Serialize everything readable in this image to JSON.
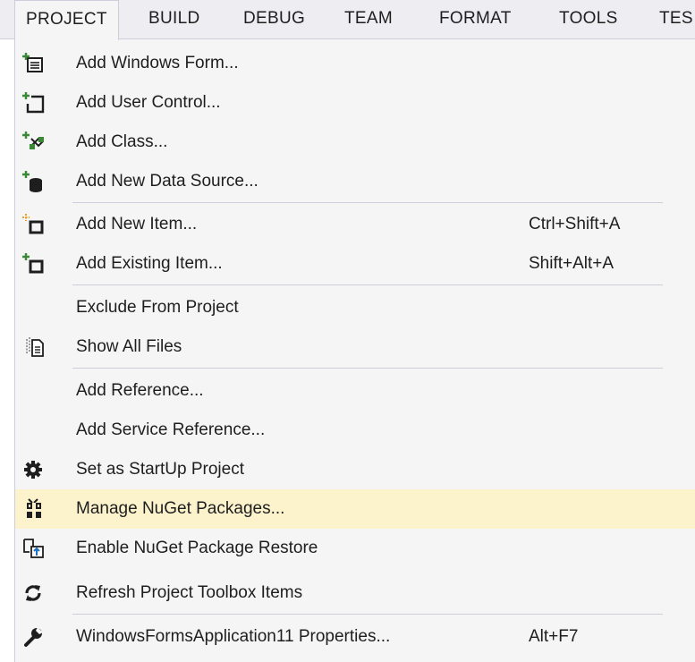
{
  "menubar": {
    "items": [
      {
        "label": "PROJECT",
        "active": true
      },
      {
        "label": "BUILD"
      },
      {
        "label": "DEBUG"
      },
      {
        "label": "TEAM"
      },
      {
        "label": "FORMAT"
      },
      {
        "label": "TOOLS"
      },
      {
        "label": "TES"
      }
    ]
  },
  "menu": {
    "highlight_color": "#fcf3cd",
    "items": [
      {
        "label": "Add Windows Form...",
        "icon": "add-windows-form-icon"
      },
      {
        "label": "Add User Control...",
        "icon": "add-user-control-icon"
      },
      {
        "label": "Add Class...",
        "icon": "add-class-icon"
      },
      {
        "label": "Add New Data Source...",
        "icon": "add-data-source-icon"
      },
      {
        "label": "Add New Item...",
        "shortcut": "Ctrl+Shift+A",
        "icon": "add-new-item-icon"
      },
      {
        "label": "Add Existing Item...",
        "shortcut": "Shift+Alt+A",
        "icon": "add-existing-item-icon"
      },
      {
        "label": "Exclude From Project"
      },
      {
        "label": "Show All Files",
        "icon": "show-all-files-icon"
      },
      {
        "label": "Add Reference..."
      },
      {
        "label": "Add Service Reference..."
      },
      {
        "label": "Set as StartUp Project",
        "icon": "gear-icon"
      },
      {
        "label": "Manage NuGet Packages...",
        "icon": "nuget-package-icon",
        "highlighted": true
      },
      {
        "label": "Enable NuGet Package Restore",
        "icon": "package-restore-icon"
      },
      {
        "label": "Refresh Project Toolbox Items",
        "icon": "refresh-icon"
      },
      {
        "label": "WindowsFormsApplication11 Properties...",
        "shortcut": "Alt+F7",
        "icon": "wrench-icon"
      }
    ]
  }
}
